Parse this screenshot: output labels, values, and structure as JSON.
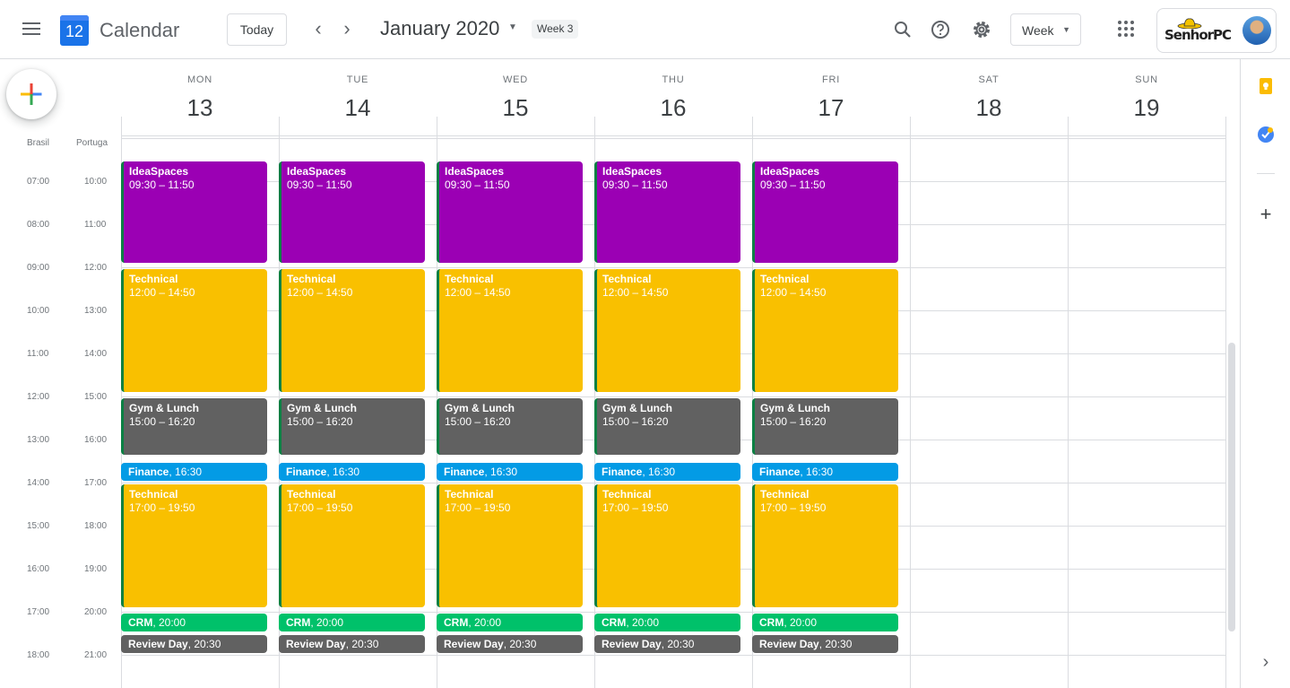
{
  "header": {
    "app_title": "Calendar",
    "logo_day": "12",
    "today_label": "Today",
    "prev_icon": "chevron-left-icon",
    "next_icon": "chevron-right-icon",
    "date_title": "January 2020",
    "week_badge": "Week 3",
    "view_label": "Week",
    "brand_name": "SenhorPC"
  },
  "timezones": {
    "primary": "Brasil",
    "secondary": "Portuga"
  },
  "days": [
    {
      "dow": "MON",
      "num": "13"
    },
    {
      "dow": "TUE",
      "num": "14"
    },
    {
      "dow": "WED",
      "num": "15"
    },
    {
      "dow": "THU",
      "num": "16"
    },
    {
      "dow": "FRI",
      "num": "17"
    },
    {
      "dow": "SAT",
      "num": "18"
    },
    {
      "dow": "SUN",
      "num": "19"
    }
  ],
  "time_rows": [
    {
      "primary": "07:00",
      "secondary": "10:00"
    },
    {
      "primary": "08:00",
      "secondary": "11:00"
    },
    {
      "primary": "09:00",
      "secondary": "12:00"
    },
    {
      "primary": "10:00",
      "secondary": "13:00"
    },
    {
      "primary": "11:00",
      "secondary": "14:00"
    },
    {
      "primary": "12:00",
      "secondary": "15:00"
    },
    {
      "primary": "13:00",
      "secondary": "16:00"
    },
    {
      "primary": "14:00",
      "secondary": "17:00"
    },
    {
      "primary": "15:00",
      "secondary": "18:00"
    },
    {
      "primary": "16:00",
      "secondary": "19:00"
    },
    {
      "primary": "17:00",
      "secondary": "20:00"
    },
    {
      "primary": "18:00",
      "secondary": "21:00"
    }
  ],
  "event_types": [
    {
      "title": "IdeaSpaces",
      "time": "09:30 – 11:50",
      "color": "#9b00b4",
      "start": 9.5,
      "end": 11.9,
      "single_line": false,
      "stripe": true
    },
    {
      "title": "Technical",
      "time": "12:00 – 14:50",
      "color": "#f9c000",
      "start": 12.0,
      "end": 14.9,
      "single_line": false,
      "stripe": true
    },
    {
      "title": "Gym & Lunch",
      "time": "15:00 – 16:20",
      "color": "#616161",
      "start": 15.0,
      "end": 16.35,
      "single_line": false,
      "stripe": true
    },
    {
      "title": "Finance",
      "time": ", 16:30",
      "color": "#039be5",
      "start": 16.5,
      "end": 16.95,
      "single_line": true,
      "stripe": false
    },
    {
      "title": "Technical",
      "time": "17:00 – 19:50",
      "color": "#f9c000",
      "start": 17.0,
      "end": 19.9,
      "single_line": false,
      "stripe": true
    },
    {
      "title": "CRM",
      "time": ", 20:00",
      "color": "#00c16a",
      "start": 20.0,
      "end": 20.45,
      "single_line": true,
      "stripe": false
    },
    {
      "title": "Review Day",
      "time": ", 20:30",
      "color": "#616161",
      "start": 20.5,
      "end": 20.95,
      "single_line": true,
      "stripe": false
    }
  ],
  "event_days": [
    0,
    1,
    2,
    3,
    4
  ],
  "colors": {
    "accent": "#1a73e8",
    "grid": "#dadce0",
    "text_muted": "#70757a"
  }
}
